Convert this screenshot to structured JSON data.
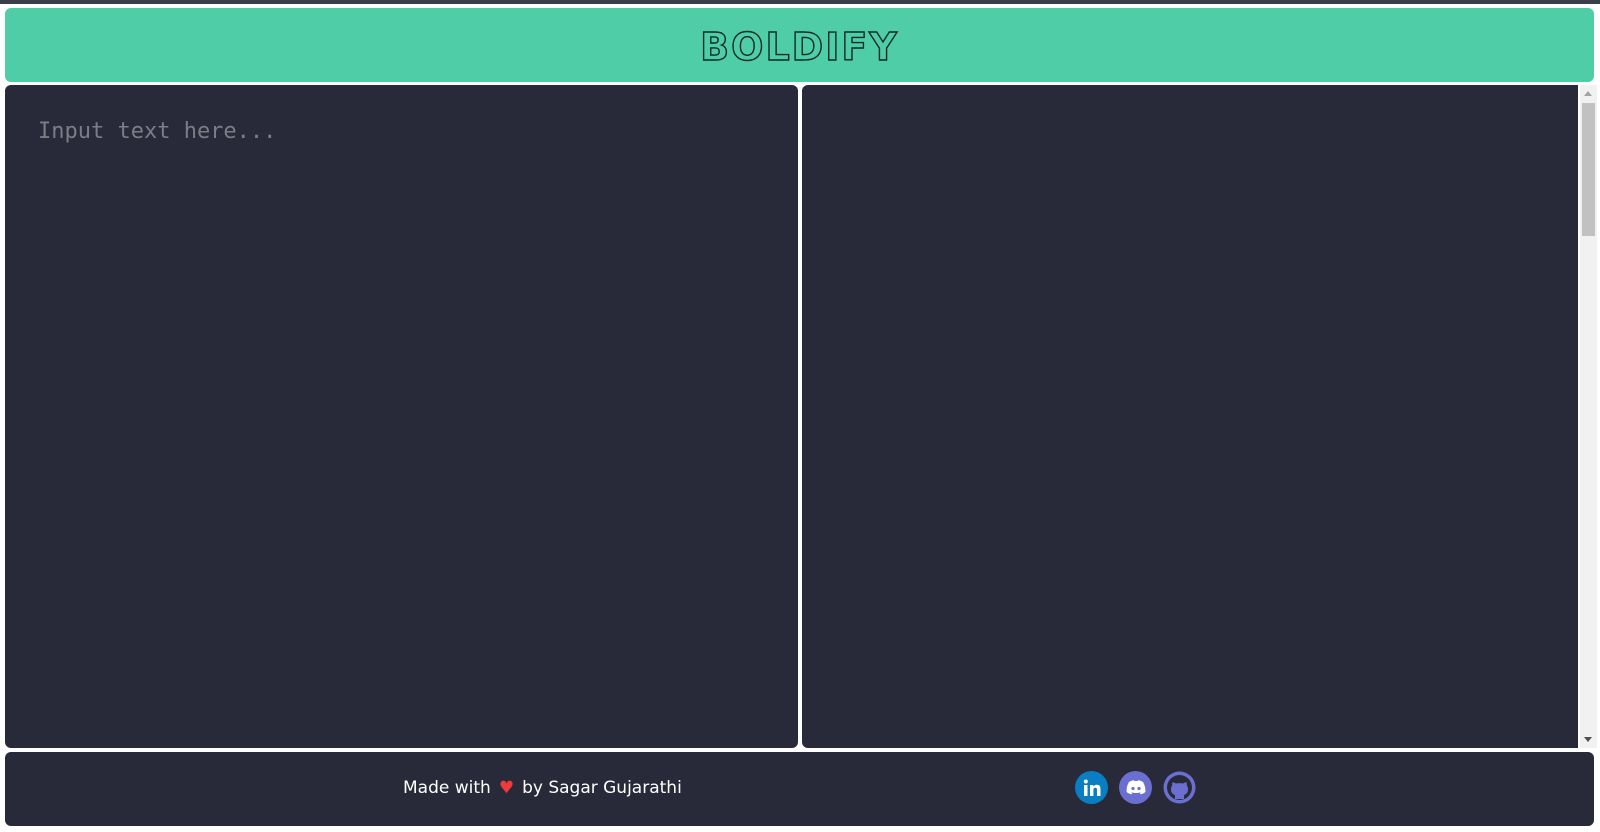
{
  "header": {
    "title": "BOLDIFY"
  },
  "editor": {
    "input_placeholder": "Input text here...",
    "input_value": "",
    "output_value": ""
  },
  "footer": {
    "made_with": "Made with",
    "by_text": "by Sagar Gujarathi",
    "heart": "♥",
    "links": [
      {
        "name": "linkedin-icon",
        "color": "#0a7ec2"
      },
      {
        "name": "discord-icon",
        "color": "#6a6fd0"
      },
      {
        "name": "github-icon",
        "color": "#6a6fd0"
      }
    ]
  }
}
